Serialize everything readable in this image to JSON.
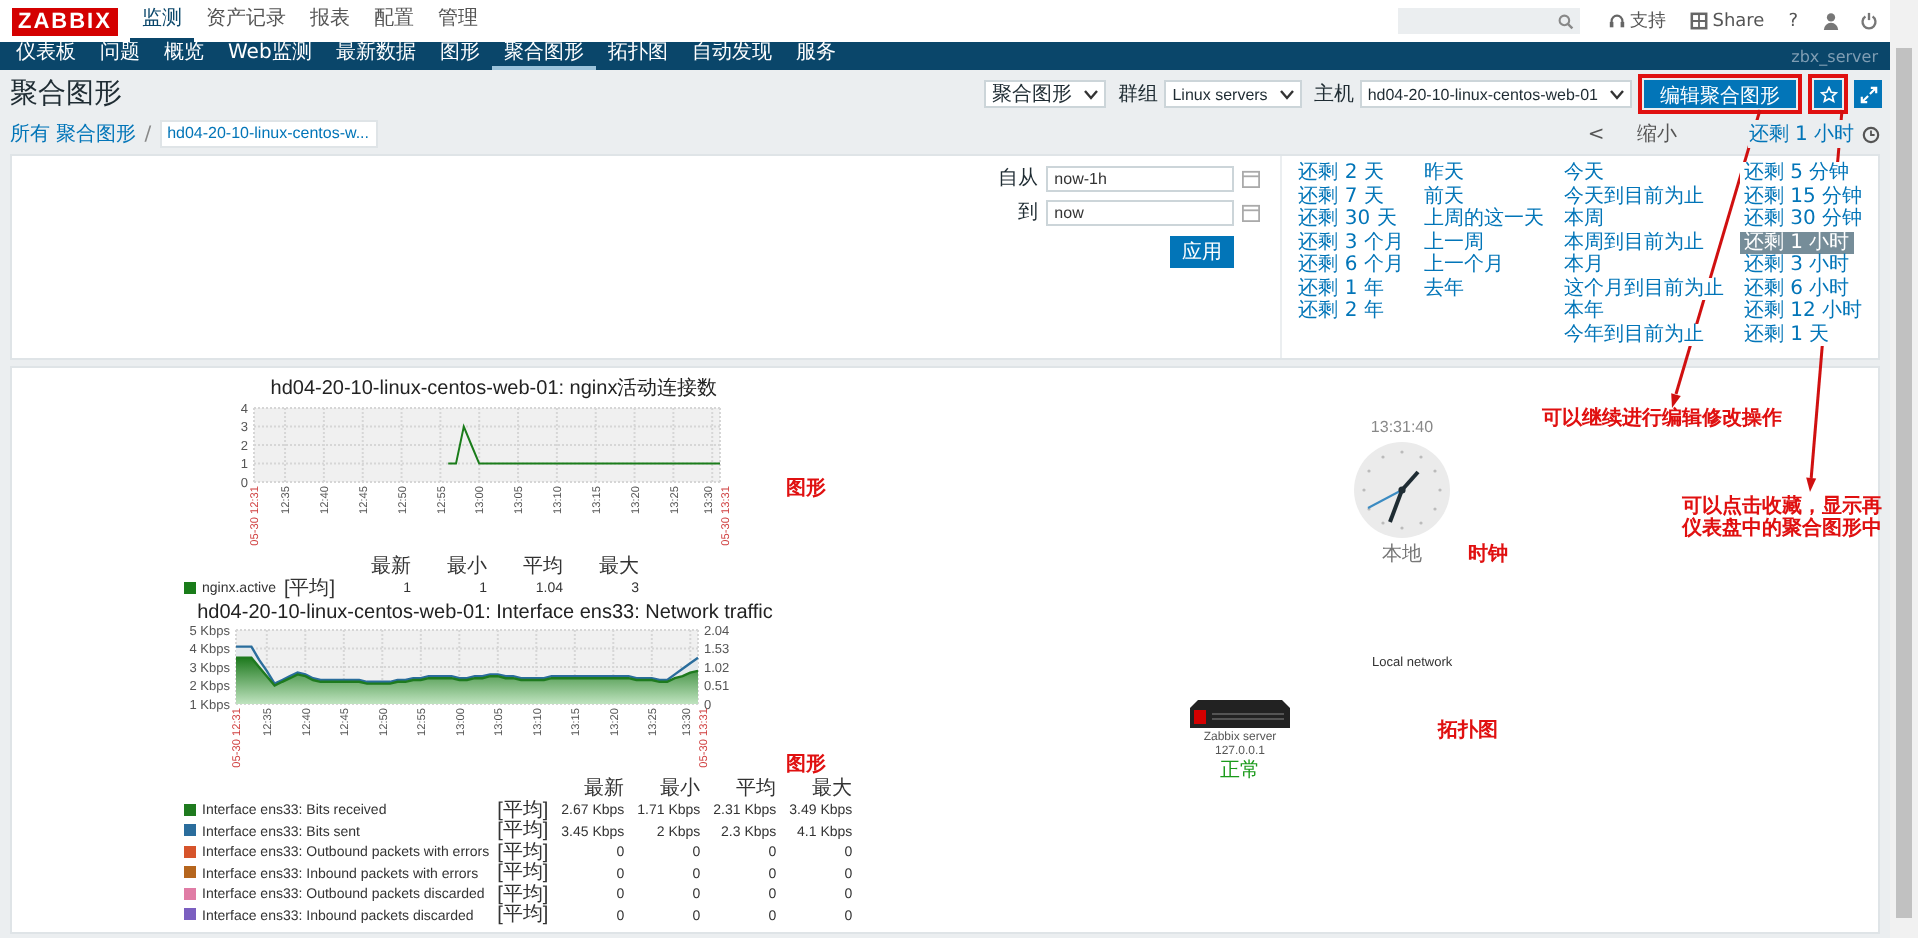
{
  "top_bar": {
    "logo": "ZABBIX",
    "menu": [
      {
        "label": "监测",
        "selected": true
      },
      {
        "label": "资产记录",
        "selected": false
      },
      {
        "label": "报表",
        "selected": false
      },
      {
        "label": "配置",
        "selected": false
      },
      {
        "label": "管理",
        "selected": false
      }
    ],
    "links": [
      {
        "kind": "support",
        "label": "支持"
      },
      {
        "kind": "share",
        "label": "Share"
      },
      {
        "kind": "help",
        "label": "?"
      }
    ]
  },
  "nav": {
    "items": [
      {
        "label": "仪表板",
        "selected": false
      },
      {
        "label": "问题",
        "selected": false
      },
      {
        "label": "概览",
        "selected": false
      },
      {
        "label": "Web监测",
        "selected": false
      },
      {
        "label": "最新数据",
        "selected": false
      },
      {
        "label": "图形",
        "selected": false
      },
      {
        "label": "聚合图形",
        "selected": true
      },
      {
        "label": "拓扑图",
        "selected": false
      },
      {
        "label": "自动发现",
        "selected": false
      },
      {
        "label": "服务",
        "selected": false
      }
    ],
    "server": "zbx_server"
  },
  "header": {
    "title": "聚合图形",
    "selects": [
      {
        "value": "聚合图形"
      },
      {
        "label": "群组",
        "value": "Linux servers"
      },
      {
        "label": "主机",
        "value": "hd04-20-10-linux-centos-web-01"
      }
    ],
    "edit_button": {
      "label": "编辑聚合图形",
      "note": "可以继续进行编辑修改操作"
    },
    "favourite_button": {
      "note": "可以点击收藏，显示再仪表盘中的聚合图形中"
    }
  },
  "breadcrumb": {
    "items": [
      {
        "label": "所有 聚合图形",
        "selected": false
      },
      {
        "label": "hd04-20-10-linux-centos-w...",
        "selected": true
      }
    ],
    "separator": "/"
  },
  "time_nav": {
    "prev": "<",
    "zoom_out": "缩小",
    "range": "还剩 1 小时"
  },
  "filter": {
    "from": {
      "label": "自从",
      "value": "now-1h"
    },
    "to": {
      "label": "到",
      "value": "now"
    },
    "apply": "应用",
    "ranges": [
      [
        {
          "label": "还剩 2 天",
          "selected": false
        },
        {
          "label": "还剩 7 天",
          "selected": false
        },
        {
          "label": "还剩 30 天",
          "selected": false
        },
        {
          "label": "还剩 3 个月",
          "selected": false
        },
        {
          "label": "还剩 6 个月",
          "selected": false
        },
        {
          "label": "还剩 1 年",
          "selected": false
        },
        {
          "label": "还剩 2 年",
          "selected": false
        }
      ],
      [
        {
          "label": "昨天",
          "selected": false
        },
        {
          "label": "前天",
          "selected": false
        },
        {
          "label": "上周的这一天",
          "selected": false
        },
        {
          "label": "上一周",
          "selected": false
        },
        {
          "label": "上一个月",
          "selected": false
        },
        {
          "label": "去年",
          "selected": false
        }
      ],
      [
        {
          "label": "今天",
          "selected": false
        },
        {
          "label": "今天到目前为止",
          "selected": false
        },
        {
          "label": "本周",
          "selected": false
        },
        {
          "label": "本周到目前为止",
          "selected": false
        },
        {
          "label": "本月",
          "selected": false
        },
        {
          "label": "这个月到目前为止",
          "selected": false
        },
        {
          "label": "本年",
          "selected": false
        },
        {
          "label": "今年到目前为止",
          "selected": false
        }
      ],
      [
        {
          "label": "还剩 5 分钟",
          "selected": false
        },
        {
          "label": "还剩 15 分钟",
          "selected": false
        },
        {
          "label": "还剩 30 分钟",
          "selected": false
        },
        {
          "label": "还剩 1 小时",
          "selected": true
        },
        {
          "label": "还剩 3 小时",
          "selected": false
        },
        {
          "label": "还剩 6 小时",
          "selected": false
        },
        {
          "label": "还剩 12 小时",
          "selected": false
        },
        {
          "label": "还剩 1 天",
          "selected": false
        }
      ]
    ]
  },
  "screen": {
    "graphs": [
      {
        "title": "hd04-20-10-linux-centos-web-01: nginx活动连接数",
        "note": "图形",
        "chart_data": {
          "type": "line",
          "categories": [
            "05-30 12:31",
            null,
            null,
            null,
            "12:35",
            null,
            null,
            null,
            null,
            "12:40",
            null,
            null,
            null,
            null,
            "12:45",
            null,
            null,
            null,
            null,
            "12:50",
            null,
            null,
            null,
            null,
            "12:55",
            null,
            null,
            null,
            null,
            "13:00",
            null,
            null,
            null,
            null,
            "13:05",
            null,
            null,
            null,
            null,
            "13:10",
            null,
            null,
            null,
            null,
            "13:15",
            null,
            null,
            null,
            null,
            "13:20",
            null,
            null,
            null,
            null,
            "13:25",
            null,
            null,
            null,
            null,
            "13:30",
            "05-30 13:31"
          ],
          "series": [
            {
              "color": "#1a7c1a",
              "values": [
                null,
                null,
                null,
                null,
                null,
                null,
                null,
                null,
                null,
                null,
                null,
                null,
                null,
                null,
                null,
                null,
                null,
                null,
                null,
                null,
                null,
                null,
                null,
                null,
                null,
                1,
                1,
                3,
                2,
                1,
                1,
                1,
                1,
                1,
                1,
                1,
                1,
                1,
                1,
                1,
                1,
                1,
                1,
                1,
                1,
                1,
                1,
                1,
                1,
                1,
                1,
                1,
                1,
                1,
                1,
                1,
                1,
                1,
                1,
                1,
                1
              ]
            }
          ],
          "ylim": [
            0,
            4
          ],
          "yticks": [
            0,
            1,
            2,
            3,
            4
          ],
          "grid": true
        },
        "legend": {
          "columns": [
            "最新",
            "最小",
            "平均",
            "最大"
          ],
          "items": [
            {
              "name": "nginx.active",
              "color": "#1a7c1a",
              "function": "[平均]",
              "values": [
                "1",
                "1",
                "1.04",
                "3"
              ]
            }
          ]
        }
      },
      {
        "title": "hd04-20-10-linux-centos-web-01: Interface ens33: Network traffic",
        "note": "图形",
        "chart_data": {
          "type": "area",
          "categories": [
            "05-30 12:31",
            null,
            null,
            null,
            "12:35",
            null,
            null,
            null,
            null,
            "12:40",
            null,
            null,
            null,
            null,
            "12:45",
            null,
            null,
            null,
            null,
            "12:50",
            null,
            null,
            null,
            null,
            "12:55",
            null,
            null,
            null,
            null,
            "13:00",
            null,
            null,
            null,
            null,
            "13:05",
            null,
            null,
            null,
            null,
            "13:10",
            null,
            null,
            null,
            null,
            "13:15",
            null,
            null,
            null,
            null,
            "13:20",
            null,
            null,
            null,
            null,
            "13:25",
            null,
            null,
            null,
            null,
            "13:30",
            "05-30 13:31"
          ],
          "series": [
            {
              "color": "#1e7a1e",
              "values": [
                3.5,
                3.5,
                3.5,
                3.0,
                2.5,
                2.0,
                2.2,
                2.4,
                2.6,
                2.5,
                2.3,
                2.2,
                2.2,
                2.2,
                2.2,
                2.2,
                2.2,
                2.1,
                2.1,
                2.1,
                2.1,
                2.2,
                2.2,
                2.3,
                2.3,
                2.4,
                2.4,
                2.4,
                2.4,
                2.3,
                2.3,
                2.4,
                2.4,
                2.5,
                2.5,
                2.4,
                2.4,
                2.3,
                2.3,
                2.3,
                2.3,
                2.4,
                2.4,
                2.4,
                2.4,
                2.4,
                2.4,
                2.4,
                2.4,
                2.4,
                2.4,
                2.4,
                2.3,
                2.3,
                2.3,
                2.2,
                2.2,
                2.4,
                2.5,
                2.7,
                2.8
              ]
            },
            {
              "color": "#2a6d9c",
              "values": [
                4.1,
                4.1,
                4.1,
                3.4,
                2.8,
                2.1,
                2.3,
                2.5,
                2.7,
                2.6,
                2.4,
                2.3,
                2.3,
                2.3,
                2.3,
                2.3,
                2.3,
                2.2,
                2.2,
                2.2,
                2.2,
                2.3,
                2.3,
                2.4,
                2.4,
                2.5,
                2.5,
                2.5,
                2.5,
                2.4,
                2.4,
                2.5,
                2.5,
                2.6,
                2.6,
                2.5,
                2.5,
                2.4,
                2.4,
                2.4,
                2.4,
                2.5,
                2.5,
                2.5,
                2.5,
                2.5,
                2.5,
                2.5,
                2.5,
                2.5,
                2.5,
                2.5,
                2.4,
                2.4,
                2.4,
                2.3,
                2.3,
                2.6,
                2.9,
                3.2,
                3.5
              ]
            }
          ],
          "ylim": [
            1,
            5
          ],
          "yticks": [
            {
              "value": 1,
              "label": "1 Kbps"
            },
            {
              "value": 2,
              "label": "2 Kbps"
            },
            {
              "value": 3,
              "label": "3 Kbps"
            },
            {
              "value": 4,
              "label": "4 Kbps"
            },
            {
              "value": 5,
              "label": "5 Kbps"
            }
          ],
          "y2lim": [
            0,
            2.04
          ],
          "y2ticks": [
            0,
            0.51,
            1.02,
            1.53,
            2.04
          ],
          "grid": true
        },
        "legend": {
          "columns": [
            "最新",
            "最小",
            "平均",
            "最大"
          ],
          "items": [
            {
              "name": "Interface ens33: Bits received",
              "color": "#1e7a1e",
              "function": "[平均]",
              "values": [
                "2.67 Kbps",
                "1.71 Kbps",
                "2.31 Kbps",
                "3.49 Kbps"
              ]
            },
            {
              "name": "Interface ens33: Bits sent",
              "color": "#2a6d9c",
              "function": "[平均]",
              "values": [
                "3.45 Kbps",
                "2 Kbps",
                "2.3 Kbps",
                "4.1 Kbps"
              ]
            },
            {
              "name": "Interface ens33: Outbound packets with errors",
              "color": "#d6542b",
              "function": "[平均]",
              "values": [
                "0",
                "0",
                "0",
                "0"
              ]
            },
            {
              "name": "Interface ens33: Inbound packets with errors",
              "color": "#b5651d",
              "function": "[平均]",
              "values": [
                "0",
                "0",
                "0",
                "0"
              ]
            },
            {
              "name": "Interface ens33: Outbound packets discarded",
              "color": "#e07ca5",
              "function": "[平均]",
              "values": [
                "0",
                "0",
                "0",
                "0"
              ]
            },
            {
              "name": "Interface ens33: Inbound packets discarded",
              "color": "#7b5fc0",
              "function": "[平均]",
              "values": [
                "0",
                "0",
                "0",
                "0"
              ]
            }
          ]
        }
      }
    ],
    "clock": {
      "time": "13:31:40",
      "label": "本地",
      "note": "时钟"
    },
    "map": {
      "title": "Local network",
      "note": "拓扑图",
      "host": {
        "name": "Zabbix server",
        "ip": "127.0.0.1",
        "status": "正常"
      }
    }
  }
}
